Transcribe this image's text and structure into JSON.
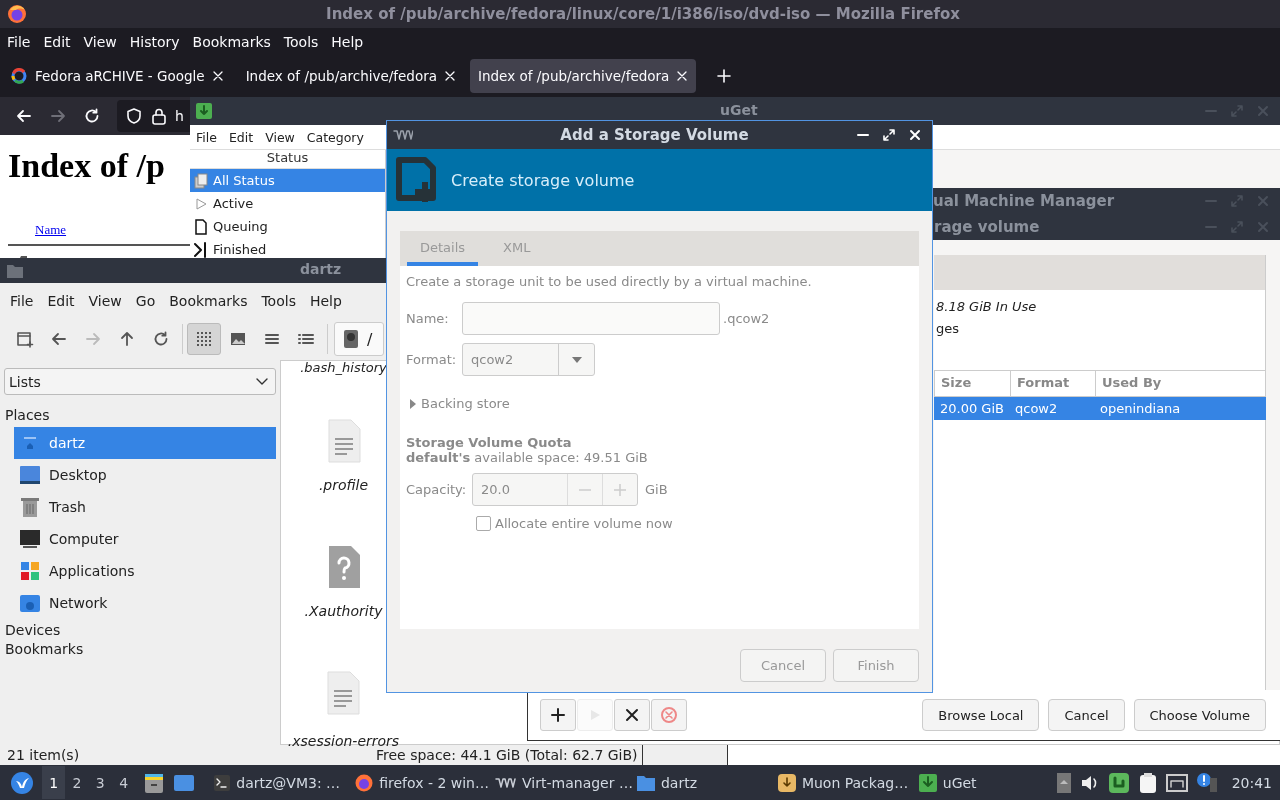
{
  "firefox": {
    "title": "Index of /pub/archive/fedora/linux/core/1/i386/iso/dvd-iso — Mozilla Firefox",
    "menu": [
      "File",
      "Edit",
      "View",
      "History",
      "Bookmarks",
      "Tools",
      "Help"
    ],
    "tabs": [
      {
        "label": "Fedora aRCHIVE - Google",
        "kind": "search",
        "selected": false
      },
      {
        "label": "Index of /pub/archive/fedora",
        "kind": "page",
        "selected": false
      },
      {
        "label": "Index of /pub/archive/fedora",
        "kind": "page",
        "selected": true
      }
    ],
    "nav": [
      {
        "kind": "back",
        "disabled": false
      },
      {
        "kind": "forward",
        "disabled": true
      },
      {
        "kind": "reload",
        "disabled": false
      }
    ],
    "address": "h",
    "page": {
      "heading": "Index of /p",
      "link": "Name"
    }
  },
  "uget": {
    "title": "uGet",
    "menu": [
      "File",
      "Edit",
      "View",
      "Category"
    ],
    "status_header": "Status",
    "categories": [
      {
        "label": "All Status",
        "kind": "all",
        "selected": true
      },
      {
        "label": "Active",
        "kind": "active",
        "selected": false
      },
      {
        "label": "Queuing",
        "kind": "queuing",
        "selected": false
      },
      {
        "label": "Finished",
        "kind": "finished",
        "selected": false
      }
    ]
  },
  "file_manager": {
    "title": "dartz",
    "menu": [
      "File",
      "Edit",
      "View",
      "Go",
      "Bookmarks",
      "Tools",
      "Help"
    ],
    "nav": [
      {
        "kind": "new-tab",
        "disabled": false
      },
      {
        "kind": "back",
        "disabled": false
      },
      {
        "kind": "forward",
        "disabled": true
      },
      {
        "kind": "up",
        "disabled": false
      },
      {
        "kind": "reload",
        "disabled": false
      }
    ],
    "views": [
      {
        "kind": "icons",
        "selected": true
      },
      {
        "kind": "thumbnails",
        "selected": false
      },
      {
        "kind": "compact",
        "selected": false
      },
      {
        "kind": "list",
        "selected": false
      }
    ],
    "path": "/",
    "side_pane": "Lists",
    "sections": [
      {
        "title": "Places",
        "items": [
          {
            "label": "dartz",
            "kind": "home",
            "selected": true
          },
          {
            "label": "Desktop",
            "kind": "desktop",
            "selected": false
          },
          {
            "label": "Trash",
            "kind": "trash",
            "selected": false
          },
          {
            "label": "Computer",
            "kind": "computer",
            "selected": false
          },
          {
            "label": "Applications",
            "kind": "applications",
            "selected": false
          },
          {
            "label": "Network",
            "kind": "network",
            "selected": false
          }
        ]
      },
      {
        "title": "Devices"
      },
      {
        "title": "Bookmarks"
      }
    ],
    "scrolled_label": ".bash_history",
    "files": [
      {
        "name": ".profile",
        "kind": "text"
      },
      {
        "name": ".Xauthority",
        "kind": "unknown"
      },
      {
        "name": ".xsession-errors",
        "kind": "text"
      }
    ],
    "status": "21 item(s)",
    "free_space": "Free space: 44.1 GiB (Total: 62.7 GiB)"
  },
  "virt_manager": {
    "title": "ual Machine Manager"
  },
  "choose_volume": {
    "title": "rage volume",
    "usage": "8.18 GiB In Use",
    "pool_type": "ges",
    "columns": [
      "Size",
      "Format",
      "Used By"
    ],
    "rows": [
      {
        "cells": [
          "20.00 GiB",
          "qcow2",
          "openindiana"
        ],
        "selected": true
      }
    ],
    "tools": [
      {
        "kind": "add",
        "disabled": false
      },
      {
        "kind": "start",
        "disabled": true
      },
      {
        "kind": "delete",
        "disabled": false
      },
      {
        "kind": "stop",
        "disabled": false
      }
    ],
    "buttons": [
      "Browse Local",
      "Cancel",
      "Choose Volume"
    ]
  },
  "dialog": {
    "title": "Add a Storage Volume",
    "header": "Create storage volume",
    "tabs": [
      {
        "label": "Details",
        "selected": true
      },
      {
        "label": "XML",
        "selected": false
      }
    ],
    "description": "Create a storage unit to be used directly by a virtual machine.",
    "name_label": "Name:",
    "name_suffix": ".qcow2",
    "format_label": "Format:",
    "format": "qcow2",
    "backing_store": {
      "label": "Backing store",
      "expanded": false
    },
    "quota_title": "Storage Volume Quota",
    "available": "**default's** available space: 49.51 GiB",
    "capacity_label": "Capacity:",
    "capacity": "20.0",
    "capacity_unit": "GiB",
    "allocate": {
      "label": "Allocate entire volume now",
      "checked": false
    },
    "buttons": [
      "Cancel",
      "Finish"
    ]
  },
  "taskbar": {
    "workspaces": [
      {
        "label": "1",
        "selected": true
      },
      {
        "label": "2",
        "selected": false
      },
      {
        "label": "3",
        "selected": false
      },
      {
        "label": "4",
        "selected": false
      }
    ],
    "tasks": [
      {
        "label": "dartz@VM3: …",
        "kind": "terminal"
      },
      {
        "label": "firefox - 2 win…",
        "kind": "firefox"
      },
      {
        "label": "Virt-manager …",
        "kind": "virt"
      },
      {
        "label": "dartz",
        "kind": "folder"
      },
      {
        "label": "Muon Packag…",
        "kind": "package"
      },
      {
        "label": "uGet",
        "kind": "uget"
      }
    ],
    "clock": "20:41"
  }
}
